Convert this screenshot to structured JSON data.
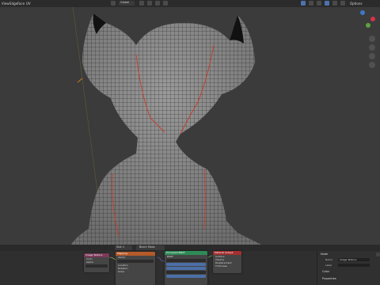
{
  "topbar": {
    "menus": [
      "View",
      "Edge",
      "Face",
      "UV"
    ],
    "mode_label": "Global",
    "options_label": "Options"
  },
  "header2": {
    "slot_label": "Slot 1",
    "material_label": "Black Mask"
  },
  "nodes": {
    "image": {
      "title": "Image Texture",
      "rows": [
        "Color",
        "Alpha"
      ]
    },
    "mapping": {
      "title": "Mapping",
      "rows": [
        "Vector",
        "Location",
        "Rotation",
        "Scale"
      ]
    },
    "bsdf": {
      "title": "Principled BSDF",
      "rows": [
        "BSDF",
        "Base Color",
        "Subsurface",
        "Metallic",
        "Roughness",
        "Alpha",
        "Normal"
      ]
    },
    "output": {
      "title": "Material Output",
      "rows": [
        "Surface",
        "Volume",
        "Displacement",
        "Thickness"
      ]
    }
  },
  "props": {
    "section_node": "Node",
    "name_label": "Name",
    "name_value": "Image Texture",
    "label_label": "Label",
    "section_color": "Color",
    "section_properties": "Properties"
  },
  "colors": {
    "mesh_edge": "#111111",
    "seam": "#c4402f",
    "node_header_image": "#7a3a5a",
    "node_header_mapping": "#b55a2a",
    "node_header_bsdf": "#2e8b57",
    "node_header_output": "#a33030"
  }
}
